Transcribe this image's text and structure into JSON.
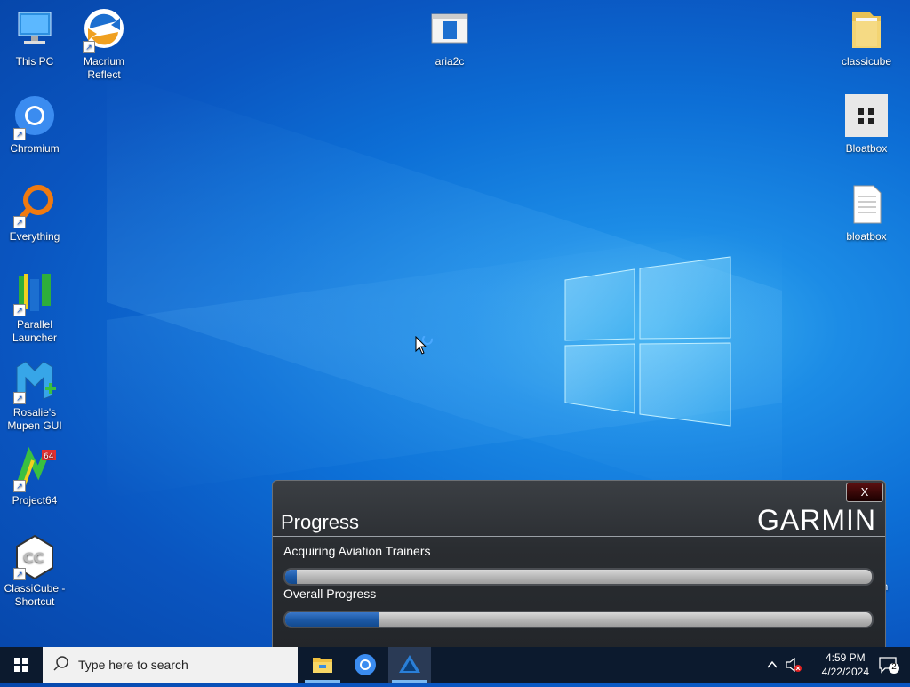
{
  "desktop": {
    "icons": [
      {
        "label": "This PC",
        "icon": "this-pc-icon"
      },
      {
        "label": "Macrium\nReflect",
        "icon": "macrium-reflect-icon"
      },
      {
        "label": "aria2c",
        "icon": "aria2c-icon"
      },
      {
        "label": "classicube",
        "icon": "folder-icon"
      },
      {
        "label": "Chromium",
        "icon": "chromium-icon"
      },
      {
        "label": "Bloatbox",
        "icon": "bloatbox-icon"
      },
      {
        "label": "Everything",
        "icon": "everything-search-icon"
      },
      {
        "label": "bloatbox",
        "icon": "text-file-icon"
      },
      {
        "label": "Parallel\nLauncher",
        "icon": "parallel-launcher-icon"
      },
      {
        "label": "Rosalie's\nMupen GUI",
        "icon": "mupen-gui-icon"
      },
      {
        "label": "Project64",
        "icon": "project64-icon"
      },
      {
        "label": "ClassiCube -\nShortcut",
        "icon": "classicube-icon"
      }
    ],
    "partial_label": "in"
  },
  "dialog": {
    "title": "Progress",
    "brand": "GARMIN",
    "close_label": "X",
    "tasks": [
      {
        "label": "Acquiring Aviation Trainers",
        "progress": 0.02
      },
      {
        "label": "Overall Progress",
        "progress": 0.16
      }
    ]
  },
  "taskbar": {
    "search_placeholder": "Type here to search",
    "apps": [
      {
        "name": "File Explorer",
        "icon": "file-explorer-icon"
      },
      {
        "name": "Chromium",
        "icon": "chromium-icon"
      },
      {
        "name": "Garmin",
        "icon": "garmin-app-icon"
      }
    ],
    "clock": {
      "time": "4:59 PM",
      "date": "4/22/2024"
    },
    "notification_count": "2"
  },
  "colors": {
    "taskbar_bg": "#0c1a2e",
    "dialog_bg": "#2a2d31",
    "progress_fill": "#1d5aa8",
    "desktop_bg": "#0a55c0"
  }
}
